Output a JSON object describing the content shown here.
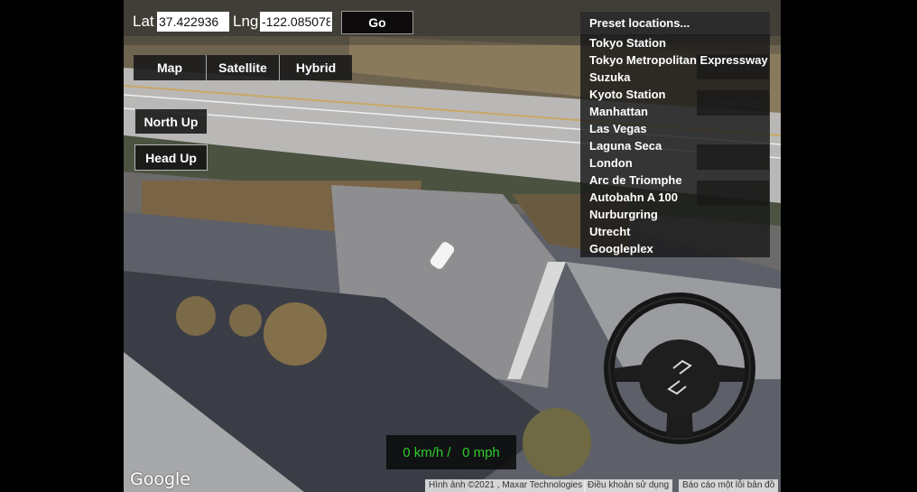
{
  "coords": {
    "lat_label": "Lat",
    "lat_value": "37.422936",
    "lng_label": "Lng",
    "lng_value": "-122.085078",
    "go_label": "Go"
  },
  "map_types": [
    {
      "label": "Map"
    },
    {
      "label": "Satellite"
    },
    {
      "label": "Hybrid"
    }
  ],
  "orientation": {
    "north_up_label": "North Up",
    "head_up_label": "Head Up"
  },
  "camera_controls": {
    "zoom_in_label": "Zoom In",
    "zoom_out_label": "Zoom Out",
    "tilt_down_label": "Tilt Down",
    "tilt_up_label": "Tilt Up"
  },
  "preset": {
    "placeholder": "Preset locations...",
    "options": [
      "Tokyo Station",
      "Tokyo Metropolitan Expressway",
      "Suzuka",
      "Kyoto Station",
      "Manhattan",
      "Las Vegas",
      "Laguna Seca",
      "London",
      "Arc de Triomphe",
      "Autobahn A 100",
      "Nurburgring",
      "Utrecht",
      "Googleplex"
    ]
  },
  "speed": {
    "text": "0 km/h /   0 mph",
    "color": "#2ecc2e"
  },
  "footer": {
    "logo": "Google",
    "imagery_credit": "Hình ảnh ©2021 , Maxar Technologies",
    "terms": "Điều khoản sử dụng",
    "report": "Báo cáo một lỗi bản đồ"
  }
}
